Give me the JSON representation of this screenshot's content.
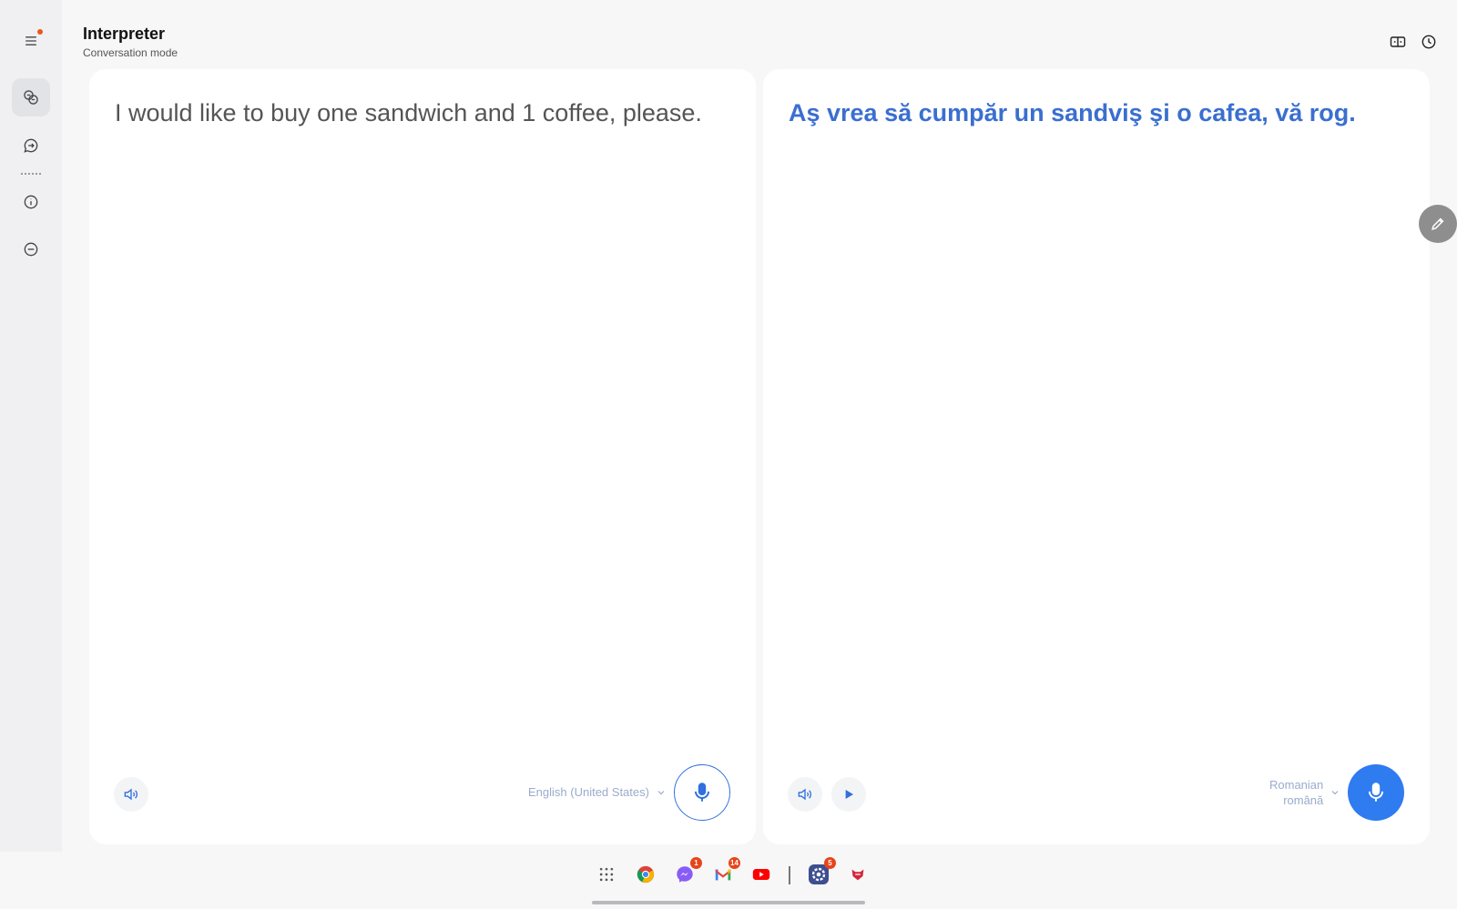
{
  "header": {
    "title": "Interpreter",
    "subtitle": "Conversation mode"
  },
  "rail": {
    "items": [
      {
        "name": "menu",
        "icon": "menu-icon",
        "has_notification": true
      },
      {
        "name": "conversation",
        "icon": "translate-chat-icon",
        "active": true
      },
      {
        "name": "chat",
        "icon": "chat-arrow-icon"
      },
      {
        "name": "info",
        "icon": "info-icon"
      },
      {
        "name": "minimize",
        "icon": "minus-circle-icon"
      }
    ]
  },
  "top_actions": [
    {
      "name": "split-view",
      "icon": "split-view-icon"
    },
    {
      "name": "history",
      "icon": "history-icon"
    }
  ],
  "left_panel": {
    "text": "I would like to buy one sandwich and 1 coffee, please.",
    "language": "English (United States)"
  },
  "right_panel": {
    "text": "Aş vrea să cumpăr un sandviş şi o cafea, vă rog.",
    "language": "Romanian",
    "language_native": "română"
  },
  "dock": {
    "items": [
      {
        "name": "apps",
        "icon": "apps-grid-icon"
      },
      {
        "name": "chrome",
        "icon": "chrome-icon"
      },
      {
        "name": "messenger",
        "icon": "messenger-icon",
        "badge": "1"
      },
      {
        "name": "gmail",
        "icon": "gmail-icon",
        "badge": "14"
      },
      {
        "name": "youtube",
        "icon": "youtube-icon"
      },
      {
        "name": "settings",
        "icon": "settings-icon",
        "badge": "5"
      },
      {
        "name": "samsung-app",
        "icon": "app-icon"
      }
    ]
  },
  "colors": {
    "accent": "#2f7bf0",
    "translated_text": "#3a6fd0",
    "badge": "#e8441a"
  }
}
